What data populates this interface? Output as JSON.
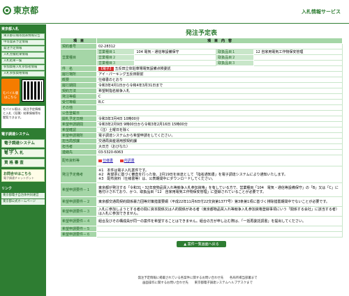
{
  "header": {
    "logo": "東京都",
    "service": "入札情報サービス"
  },
  "sidebar": {
    "section1": "東京都入札",
    "items1": [
      "東京都公報等発表情報公告",
      "申等発表予定情報",
      "発注予定情報",
      "入札見積結果情報",
      "入札結果一覧",
      "参加資格入札参加者情報",
      "入札参加資格情報"
    ],
    "mobile_label": "モバイル版はこちら",
    "note": "モバイル版は、発注予定情報と入札（見積）結果情報等を閲覧できます。",
    "section2": "電子調達システム",
    "big_items": [
      "電子調達システム(TOP)",
      "電 子 入 札",
      "資 格 審 査"
    ],
    "help_title": "お問合せはこちら",
    "help_sub": "電子調達チャットボット",
    "section3": "リンク",
    "links": [
      "東京都電子自治体共同運営",
      "東京都公式ホームページ"
    ]
  },
  "main": {
    "title": "発注予定表",
    "col_item": "項　目",
    "col_content": "項　目　内　容",
    "rows": [
      {
        "label": "契約番号",
        "value": "02-28312"
      },
      {
        "label": "工事・業種種目",
        "value": ""
      },
      {
        "label": "概要",
        "value": "仕様書のとおり"
      },
      {
        "label": "履行期間",
        "value": "令和3年4月1日から令和4年3月31日まで"
      },
      {
        "label": "契約方法",
        "value": "希望制指名競争入札"
      },
      {
        "label": "発注等級",
        "value": "C"
      },
      {
        "label": "受付等級",
        "value": "B,C"
      },
      {
        "label": "その他",
        "value": ""
      },
      {
        "label": "公告登載日",
        "value": ""
      },
      {
        "label": "開札予定日時",
        "value": "令和3年3月4日 10時00分"
      },
      {
        "label": "希望申請期間",
        "value": "令和3年2月9日 9時00分から令和3年2月16日 15時00分"
      },
      {
        "label": "希望確認",
        "value": "（注）土曜日を除く"
      },
      {
        "label": "希望申請場所",
        "value": "電子調達システムから希望申請をしてください。"
      },
      {
        "label": "担当局部課",
        "value": "交通局資産運用部契約課"
      },
      {
        "label": "担当者",
        "value": "大日方（おびなた）"
      },
      {
        "label": "連絡先",
        "value": "03-5320-6063"
      }
    ],
    "business_label": "営業種目",
    "business": {
      "a1": "営業種目１",
      "a1v": "104 電気・通信等設備保守",
      "b1": "取扱品目１",
      "b1v": "12 自家用電気工作物保安管理",
      "a2": "営業種目２",
      "b2": "取扱品目２",
      "a3": "営業種目３",
      "b3": "取扱品目３"
    },
    "project_label": "件　名",
    "project_tag": "【電子】",
    "project_value": "五反田立体駐車場電気設備点検委託",
    "place_label": "履行場所",
    "place_value": "アイ・パーキング五反田駅前",
    "materials_label": "配布資料等",
    "materials": [
      "仕様書",
      "内訳書"
    ],
    "remarks_label": "発注予定備考",
    "remarks": "※1　本件は電子入札案件です。\n※2　希望票に基づく審査を行った後、2月19日を目途として「指名通知書」を電子調達システムにより通知いたします。\n※3　配布資料（仕様書等）は、公表期間中にダウンロードしてください。",
    "req_rows": [
      {
        "label": "希望申請要件－１",
        "value": "東京都が発注する「令和31・32年度物品買入れ等競争入札参加資格」を有している方で、営業種目「104　電気・通信等設備保守」の「B」又は「C」に格付けされており、かつ、取扱品目「12　自家用電気工作物保安管理」に登録されていることが必要です。"
      },
      {
        "label": "希望申請要件－２",
        "value": "東京都交通局契約関係暴力団等対策措置要綱（平成22年11月6日付22交資第1377号）第3条第1項に基づく排除措置期間中でないことが必要です。"
      },
      {
        "label": "希望申請要件－３",
        "value": "入札に参加しようとする者の間に資本関係又は人的関係がある者（東京都物品買入れ等競争入札参加資格登録事項にいう「関係する会社」に該当する者）は入札に参加できません。"
      },
      {
        "label": "希望申請要件－４",
        "value": "組合及びその構成員が同一の案件を希望することはできません。組合の方が申し込む際は、「一括再委託調書」を提出してください。"
      },
      {
        "label": "希望申請要件－５",
        "value": ""
      },
      {
        "label": "希望申請要件－６",
        "value": ""
      }
    ],
    "back_button": "▲ 案件一覧画面へ戻る"
  },
  "footer": {
    "line1": "発注予定情報に掲載されている各案件に関するお問い合わせ先　　各局所掲当部署まで",
    "line2": "画面操作に関するお問い合わせ先　　東京都電子調達システムヘルプデスクまで"
  }
}
